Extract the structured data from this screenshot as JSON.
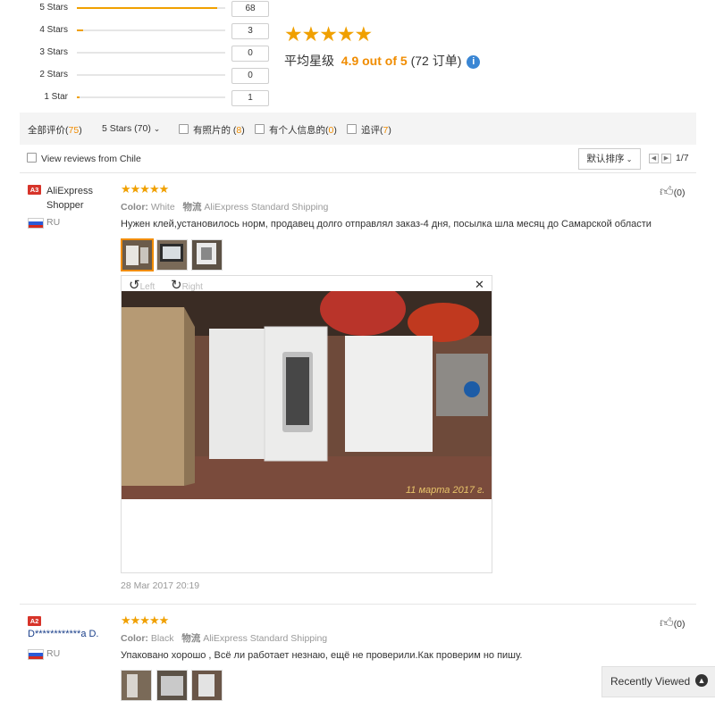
{
  "rating_summary": {
    "rows": [
      {
        "label": "5 Stars",
        "count": "68",
        "fraction": 0.944
      },
      {
        "label": "4 Stars",
        "count": "3",
        "fraction": 0.042
      },
      {
        "label": "3 Stars",
        "count": "0",
        "fraction": 0
      },
      {
        "label": "2 Stars",
        "count": "0",
        "fraction": 0
      },
      {
        "label": "1 Star",
        "count": "1",
        "fraction": 0.014
      }
    ],
    "stars_display": "★★★★★",
    "average_prefix": "平均星级",
    "average_value": "4.9 out of 5",
    "average_suffix": "(72 订单)",
    "info_icon_glyph": "i"
  },
  "filters": {
    "all_label": "全部评价",
    "all_count": "75",
    "stars_select": "5 Stars (70)",
    "with_photos_label": "有照片的",
    "with_photos_count": "8",
    "with_info_label": "有个人信息的",
    "with_info_count": "0",
    "additional_label": "追评",
    "additional_count": "7",
    "view_chile_label": "View reviews from Chile",
    "sort_label": "默认排序",
    "page_indicator": "1/7"
  },
  "reviews": [
    {
      "badge": "A3",
      "user": "AliExpress Shopper",
      "country": "RU",
      "stars": "★★★★★",
      "color_label": "Color:",
      "color_value": "White",
      "shipping_label": "物流",
      "shipping_value": "AliExpress Standard Shipping",
      "text": "Нужен клей,установилось норм, продавец долго отправлял заказ-4 дня, посылка шла месяц до Самарской области",
      "likes": "(0)",
      "rotate_left": "Left",
      "rotate_right": "Right",
      "photo_caption": "11 марта 2017 г.",
      "date": "28 Mar 2017 20:19"
    },
    {
      "badge": "A2",
      "user": "D************a D.",
      "country": "RU",
      "stars": "★★★★★",
      "color_label": "Color:",
      "color_value": "Black",
      "shipping_label": "物流",
      "shipping_value": "AliExpress Standard Shipping",
      "text": "Упаковано хорошо , Всё ли работает незнаю, ещё не проверили.Как проверим но пишу.",
      "likes": "(0)"
    }
  ],
  "recently_viewed": "Recently Viewed",
  "colors": {
    "accent": "#f08c00",
    "star": "#f0a000",
    "badge": "#d7342a",
    "link_blue": "#1a3f8a"
  }
}
